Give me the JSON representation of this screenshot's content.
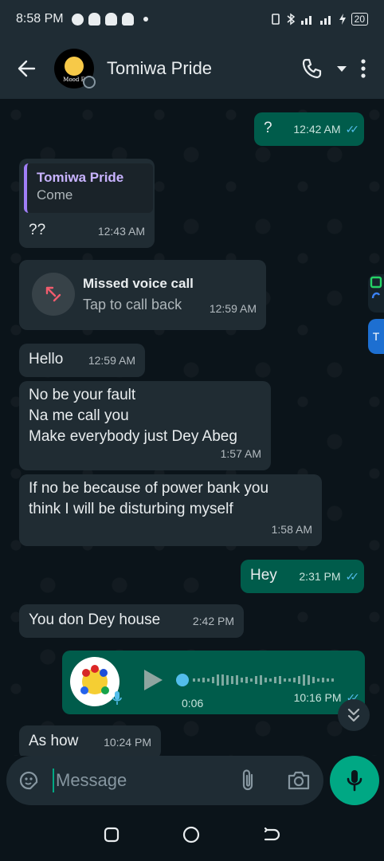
{
  "status_bar": {
    "time": "8:58 PM",
    "battery": "20"
  },
  "header": {
    "contact_name": "Tomiwa Pride",
    "avatar_caption": "Mood E"
  },
  "messages": [
    {
      "direction": "out",
      "text": "?",
      "time": "12:42 AM",
      "status": "read"
    },
    {
      "direction": "in",
      "quoted_name": "Tomiwa Pride",
      "quoted_text": "Come",
      "text": "??",
      "time": "12:43 AM"
    },
    {
      "direction": "in",
      "type": "missed_call",
      "title": "Missed voice call",
      "subtitle": "Tap to call back",
      "time": "12:59 AM"
    },
    {
      "direction": "in",
      "text": "Hello",
      "time": "12:59 AM"
    },
    {
      "direction": "in",
      "lines": [
        "No be your fault",
        "Na me call you",
        "Make everybody just Dey Abeg"
      ],
      "time": "1:57 AM"
    },
    {
      "direction": "in",
      "lines": [
        "If no be because of power bank you",
        "think I will be disturbing myself"
      ],
      "time": "1:58 AM"
    },
    {
      "direction": "out",
      "text": "Hey",
      "time": "2:31 PM",
      "status": "read"
    },
    {
      "direction": "in",
      "text": "You don Dey house",
      "time": "2:42 PM"
    },
    {
      "direction": "out",
      "type": "voice_note",
      "duration": "0:06",
      "time": "10:16 PM",
      "status": "read"
    },
    {
      "direction": "in",
      "text": "As how",
      "time": "10:24 PM"
    }
  ],
  "composer": {
    "placeholder": "Message"
  },
  "icons": {
    "back": "arrow-left-icon",
    "call": "phone-icon",
    "more": "more-vertical-icon",
    "emoji": "sticker-icon",
    "attach": "paperclip-icon",
    "camera": "camera-icon",
    "mic": "mic-icon",
    "scroll": "double-chevron-down-icon"
  },
  "colors": {
    "incoming_bubble": "#202c33",
    "outgoing_bubble": "#005c4b",
    "accent": "#00a884",
    "read_ticks": "#53bdeb",
    "missed_call": "#f15c6d"
  }
}
